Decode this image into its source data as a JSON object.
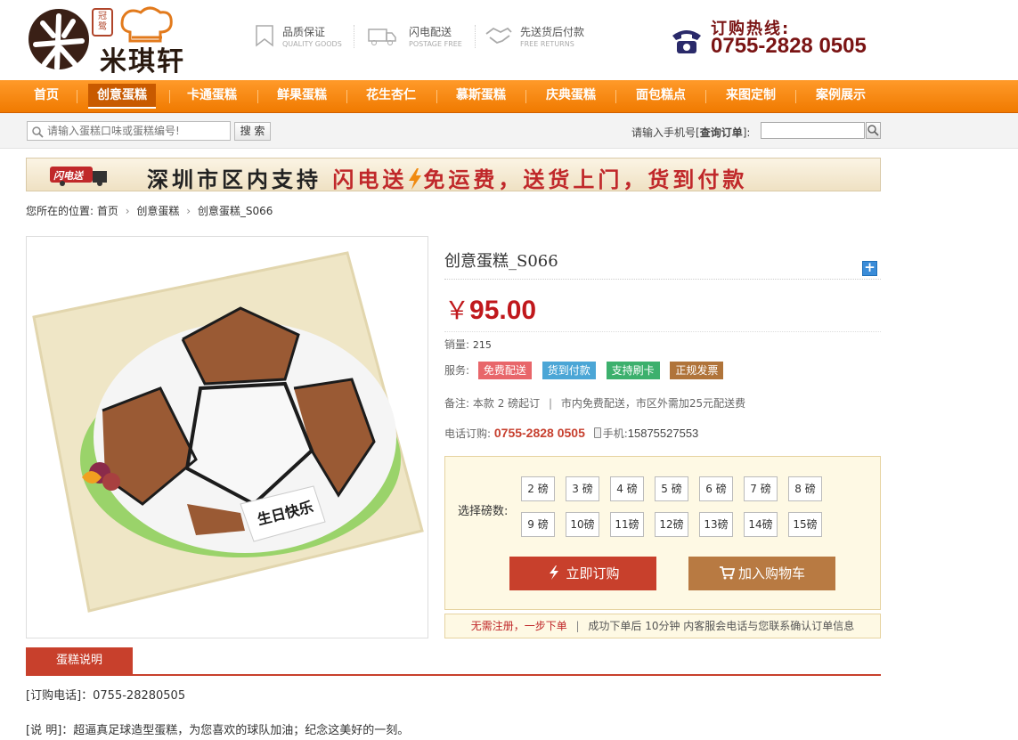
{
  "header": {
    "logo_text": "米琪轩",
    "logo_seal": "冠鹭",
    "features": [
      {
        "title": "品质保证",
        "sub": "QUALITY GOODS",
        "icon": "bookmark-icon"
      },
      {
        "title": "闪电配送",
        "sub": "POSTAGE FREE",
        "icon": "truck-icon"
      },
      {
        "title": "先送货后付款",
        "sub": "FREE RETURNS",
        "icon": "handshake-icon"
      }
    ],
    "hotline_label": "订购热线:",
    "hotline_number": "0755-2828 0505"
  },
  "nav": {
    "items": [
      "首页",
      "创意蛋糕",
      "卡通蛋糕",
      "鲜果蛋糕",
      "花生杏仁",
      "慕斯蛋糕",
      "庆典蛋糕",
      "面包糕点",
      "来图定制",
      "案例展示"
    ],
    "active": "创意蛋糕"
  },
  "search": {
    "placeholder": "请输入蛋糕口味或蛋糕编号!",
    "button": "搜 索",
    "order_label_pre": "请输入手机号[",
    "order_label_bold": "查询订单",
    "order_label_post": "]:"
  },
  "banner": {
    "part1": "深圳市区内支持 ",
    "part2": "闪电送",
    "part3": "免运费，送货上门，货到付款",
    "logo_text": "闪电送"
  },
  "breadcrumb": {
    "prefix": "您所在的位置:",
    "items": [
      "首页",
      "创意蛋糕",
      "创意蛋糕_S066"
    ]
  },
  "product": {
    "title": "创意蛋糕_S066",
    "currency": "￥",
    "price": "95.00",
    "sales_label": "销量:",
    "sales_value": "215",
    "service_label": "服务:",
    "services": [
      "免费配送",
      "货到付款",
      "支持刷卡",
      "正规发票"
    ],
    "note_label": "备注:",
    "note_a": "本款 2 磅起订",
    "note_b": "市内免费配送，市区外需加25元配送费",
    "phone_label": "电话订购:",
    "phone_value": "0755-2828 0505",
    "mobile_label": "手机:",
    "mobile_value": "15875527553",
    "cake_plaque": "生日快乐"
  },
  "weights": {
    "label": "选择磅数:",
    "row1": [
      "2 磅",
      "3 磅",
      "4 磅",
      "5 磅",
      "6 磅",
      "7 磅",
      "8 磅"
    ],
    "row2": [
      "9 磅",
      "10磅",
      "11磅",
      "12磅",
      "13磅",
      "14磅",
      "15磅"
    ]
  },
  "actions": {
    "buy": "立即订购",
    "cart": "加入购物车"
  },
  "notice": {
    "red": "无需注册，一步下单",
    "rest": "成功下单后 10分钟 内客服会电话与您联系确认订单信息"
  },
  "tabs": {
    "desc_tab": "蛋糕说明"
  },
  "description": {
    "line1": "[订购电话]：0755-28280505",
    "line2": "[说 明]：超逼真足球造型蛋糕，为您喜欢的球队加油；纪念这美好的一刻。"
  },
  "colors": {
    "nav_orange": "#f58a10",
    "brand_red": "#c8402c",
    "price_red": "#c0181c",
    "cart_brown": "#b87a42"
  }
}
